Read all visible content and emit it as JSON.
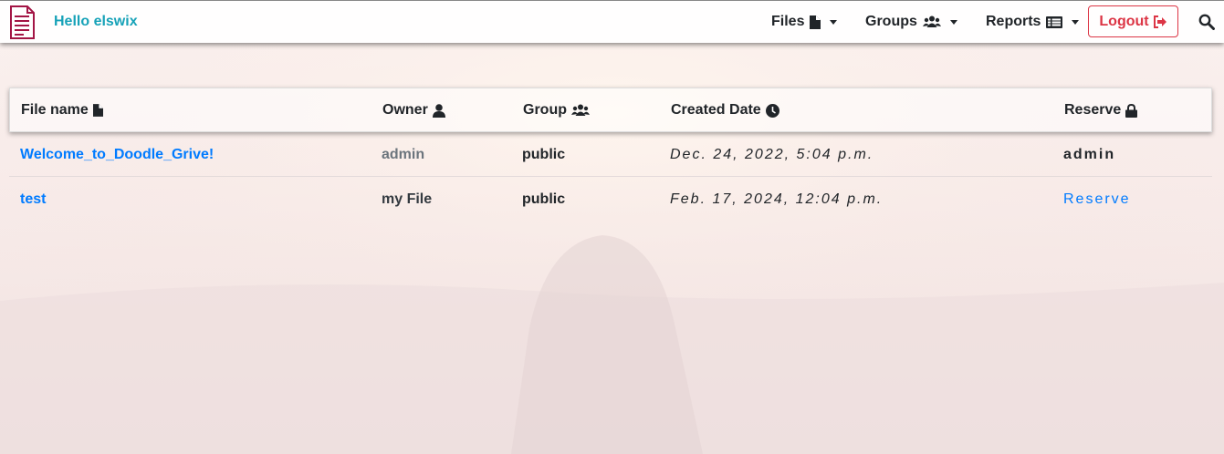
{
  "navbar": {
    "logo_icon": "document-icon",
    "greeting": "Hello elswix",
    "menus": [
      {
        "label": "Files",
        "icon": "file-icon"
      },
      {
        "label": "Groups",
        "icon": "users-icon"
      },
      {
        "label": "Reports",
        "icon": "list-icon"
      }
    ],
    "logout": {
      "label": "Logout",
      "icon": "sign-out-icon"
    },
    "search_icon": "search-icon"
  },
  "table": {
    "headers": [
      {
        "label": "File name",
        "icon": "file-icon"
      },
      {
        "label": "Owner",
        "icon": "user-icon"
      },
      {
        "label": "Group",
        "icon": "users-icon"
      },
      {
        "label": "Created Date",
        "icon": "clock-icon"
      },
      {
        "label": "Reserve",
        "icon": "lock-icon"
      }
    ],
    "rows": [
      {
        "file_name": "Welcome_to_Doodle_Grive!",
        "owner": "admin",
        "group": "public",
        "created": "Dec. 24, 2022, 5:04 p.m.",
        "reserve": "admin",
        "reserve_is_link": false
      },
      {
        "file_name": "test",
        "owner": "my File",
        "group": "public",
        "created": "Feb. 17, 2024, 12:04 p.m.",
        "reserve": "Reserve",
        "reserve_is_link": true
      }
    ]
  },
  "colors": {
    "brand": "#a31545",
    "greeting": "#17a2b8",
    "link": "#007bff",
    "danger": "#dc3545"
  }
}
